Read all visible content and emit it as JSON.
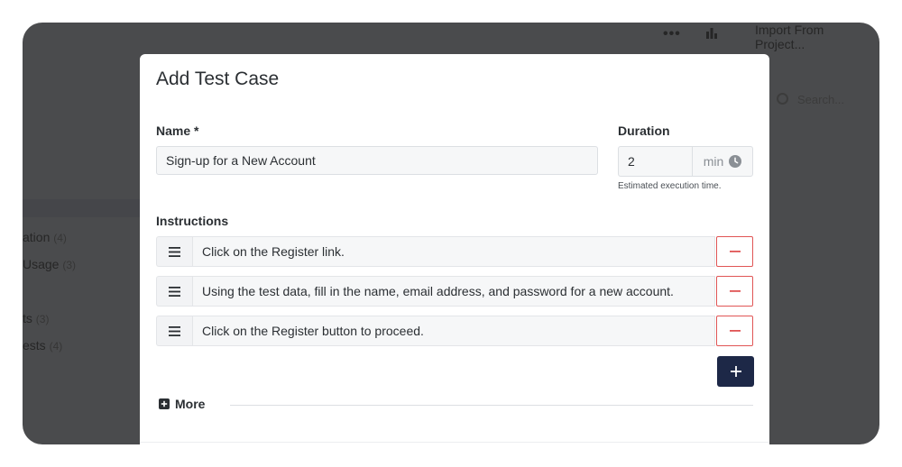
{
  "background": {
    "toolbar": {
      "ellipsis": "•••",
      "import_label": "Import From Project..."
    },
    "search_placeholder": "Search...",
    "sidebar_items": [
      {
        "label": "ation",
        "count": "(4)"
      },
      {
        "label": "Usage",
        "count": "(3)"
      },
      {
        "label": "ts",
        "count": "(3)"
      },
      {
        "label": "ests",
        "count": "(4)"
      }
    ]
  },
  "modal": {
    "title": "Add Test Case",
    "name_label": "Name *",
    "name_value": "Sign-up for a New Account",
    "duration_label": "Duration",
    "duration_value": "2",
    "duration_unit": "min",
    "duration_help": "Estimated execution time.",
    "instructions_label": "Instructions",
    "steps": [
      {
        "text": "Click on the Register link."
      },
      {
        "text": "Using the test data, fill in the name, email address, and password for a new account."
      },
      {
        "text": "Click on the Register button to proceed."
      }
    ],
    "more_label": "More"
  },
  "colors": {
    "accent": "#1d2847",
    "danger": "#e05555",
    "overlay": "#4a4b4d"
  },
  "icons": {
    "drag": "drag-handle-icon",
    "remove": "minus-icon",
    "add": "plus-icon",
    "clock": "clock-icon",
    "more": "plus-square-icon"
  }
}
